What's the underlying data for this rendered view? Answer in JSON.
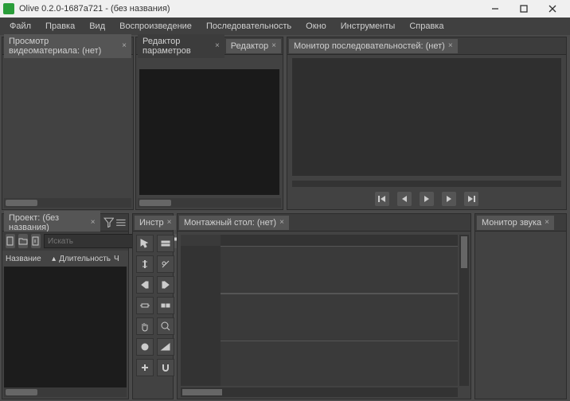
{
  "window": {
    "title": "Olive 0.2.0-1687a721 - (без названия)"
  },
  "menu": [
    "Файл",
    "Правка",
    "Вид",
    "Воспроизведение",
    "Последовательность",
    "Окно",
    "Инструменты",
    "Справка"
  ],
  "panels": {
    "source_viewer": {
      "tab": "Просмотр видеоматериала: (нет)"
    },
    "param_editor": {
      "tab": "Редактор параметров"
    },
    "redactor": {
      "tab": "Редактор"
    },
    "sequence_viewer": {
      "tab": "Монитор последовательностей: (нет)"
    },
    "project": {
      "tab": "Проект: (без названия)",
      "search_placeholder": "Искать",
      "col_name": "Название",
      "col_duration": "Длительность",
      "col_ch": "Ч"
    },
    "tools": {
      "tab": "Инстр"
    },
    "timeline": {
      "tab": "Монтажный стол: (нет)"
    },
    "audio_monitor": {
      "tab": "Монитор звука"
    }
  },
  "tool_names": [
    "pointer",
    "tracks",
    "edit",
    "razor",
    "ripple-in",
    "ripple-out",
    "slip",
    "slide",
    "hand",
    "zoom",
    "record",
    "transition",
    "add",
    "snap"
  ]
}
